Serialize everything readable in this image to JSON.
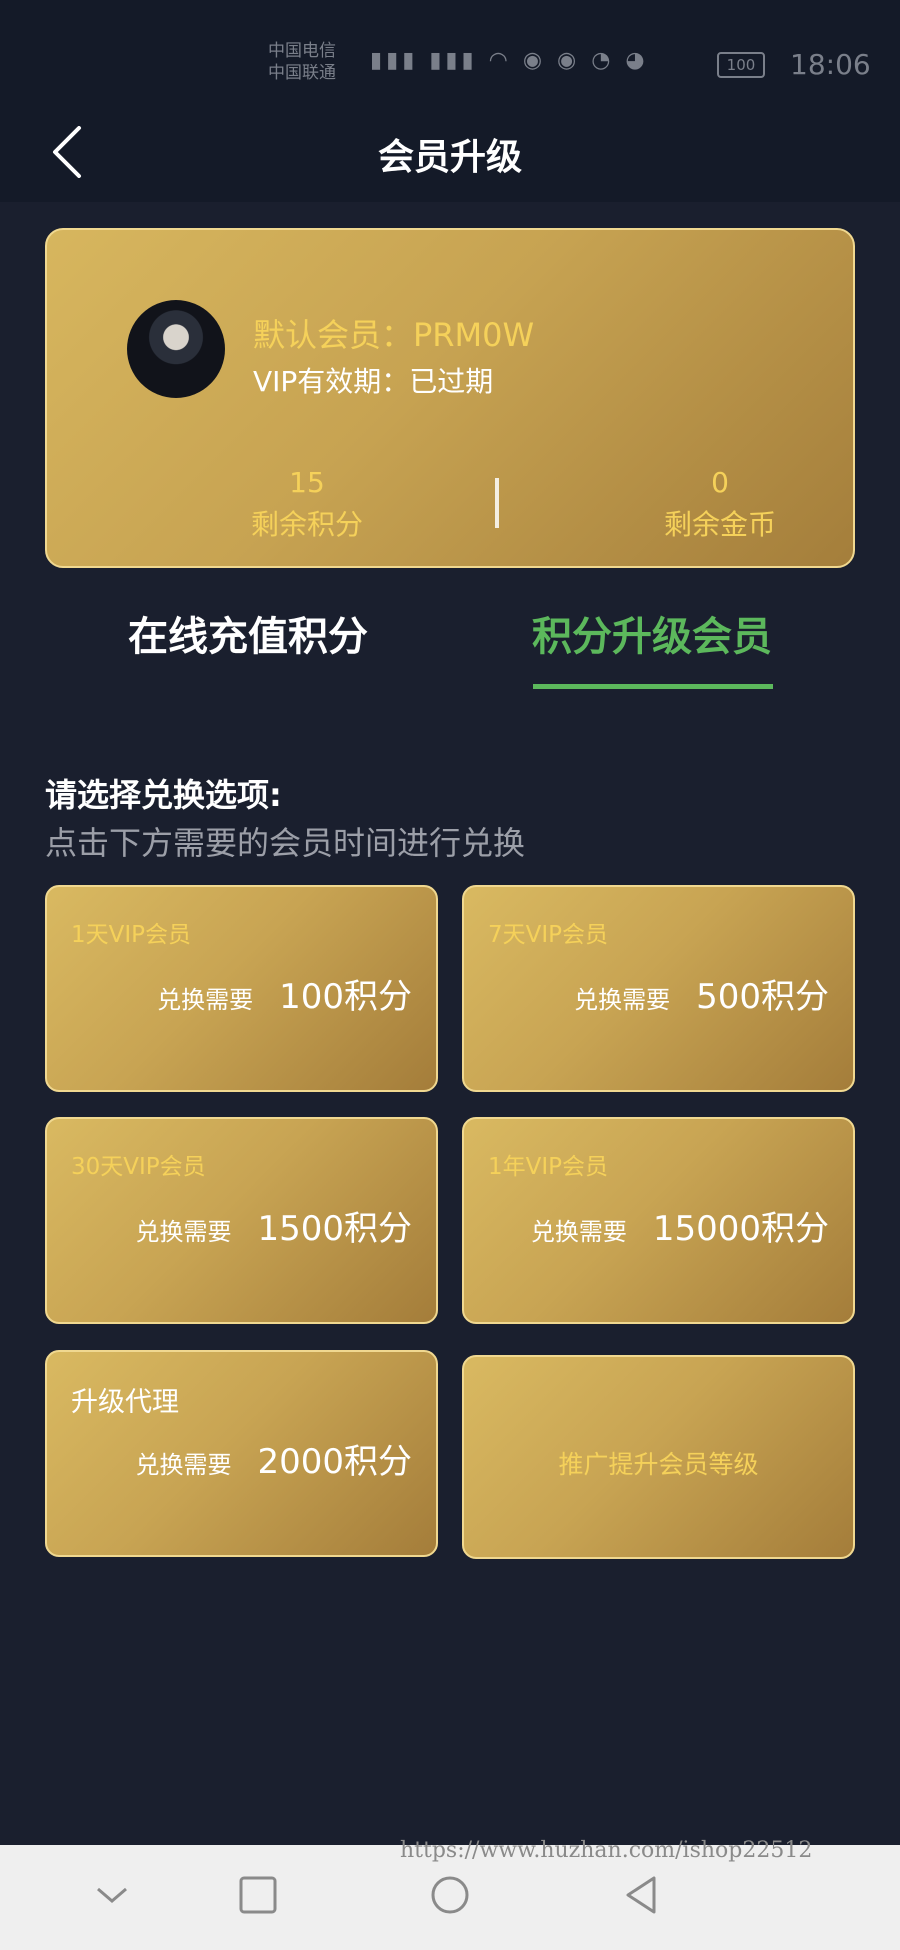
{
  "status_bar": {
    "carrier1": "中国电信",
    "carrier2": "中国联通",
    "battery": "100",
    "time": "18:06"
  },
  "header": {
    "title": "会员升级"
  },
  "member": {
    "name": "默认会员：PRM0W",
    "vip_expiry": "VIP有效期：已过期",
    "points_value": "15",
    "points_label": "剩余积分",
    "coins_value": "0",
    "coins_label": "剩余金币"
  },
  "tabs": [
    {
      "label": "在线充值积分",
      "active": false
    },
    {
      "label": "积分升级会员",
      "active": true
    }
  ],
  "section": {
    "title": "请选择兑换选项:",
    "subtitle": "点击下方需要的会员时间进行兑换"
  },
  "options": [
    {
      "name": "1天VIP会员",
      "need": "兑换需要",
      "price": "100积分"
    },
    {
      "name": "7天VIP会员",
      "need": "兑换需要",
      "price": "500积分"
    },
    {
      "name": "30天VIP会员",
      "need": "兑换需要",
      "price": "1500积分"
    },
    {
      "name": "1年VIP会员",
      "need": "兑换需要",
      "price": "15000积分"
    },
    {
      "name": "升级代理",
      "need": "兑换需要",
      "price": "2000积分"
    },
    {
      "name": "推广提升会员等级"
    }
  ],
  "watermark": "https://www.huzhan.com/ishop22512",
  "colors": {
    "accent_green": "#5cb85c",
    "gold_text": "#f5d15a",
    "background": "#1a1f2e"
  }
}
